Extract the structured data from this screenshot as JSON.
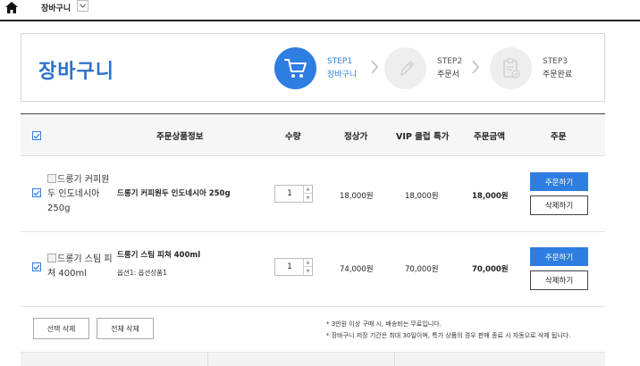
{
  "breadcrumb": {
    "current": "장바구니"
  },
  "header": {
    "title": "장바구니",
    "steps": [
      {
        "num": "STEP1",
        "label": "장바구니",
        "active": true,
        "icon": "cart-icon"
      },
      {
        "num": "STEP2",
        "label": "주문서",
        "active": false,
        "icon": "pencil-icon"
      },
      {
        "num": "STEP3",
        "label": "주문완료",
        "active": false,
        "icon": "clipboard-check-icon"
      }
    ]
  },
  "table": {
    "columns": [
      "주문상품정보",
      "수량",
      "정상가",
      "VIP 클럽 특가",
      "주문금액",
      "주문"
    ],
    "rows": [
      {
        "thumb_alt": "드롱기 커피원두 인도네시아 250g",
        "name": "드롱기 커피원두 인도네시아 250g",
        "option": "",
        "qty": "1",
        "regular_price": "18,000원",
        "vip_price": "18,000원",
        "order_amount": "18,000원",
        "order_label": "주문하기",
        "delete_label": "삭제하기"
      },
      {
        "thumb_alt": "드롱기 스팀 피쳐 400ml",
        "name": "드롱기 스팀 피쳐 400ml",
        "option": "옵션1: 옵션상품1",
        "qty": "1",
        "regular_price": "74,000원",
        "vip_price": "70,000원",
        "order_amount": "70,000원",
        "order_label": "주문하기",
        "delete_label": "삭제하기"
      }
    ]
  },
  "actions": {
    "delete_selected": "선택 삭제",
    "delete_all": "전체 삭제"
  },
  "notes": [
    "* 3만원 이상 구매 시, 배송비는 무료입니다.",
    "* 장바구니 저장 기간은 최대 30일이며, 특가 상품의 경우 판매 종료 시 자동으로 삭제 됩니다."
  ],
  "colors": {
    "accent": "#2e7de0",
    "title": "#2a72c8"
  }
}
